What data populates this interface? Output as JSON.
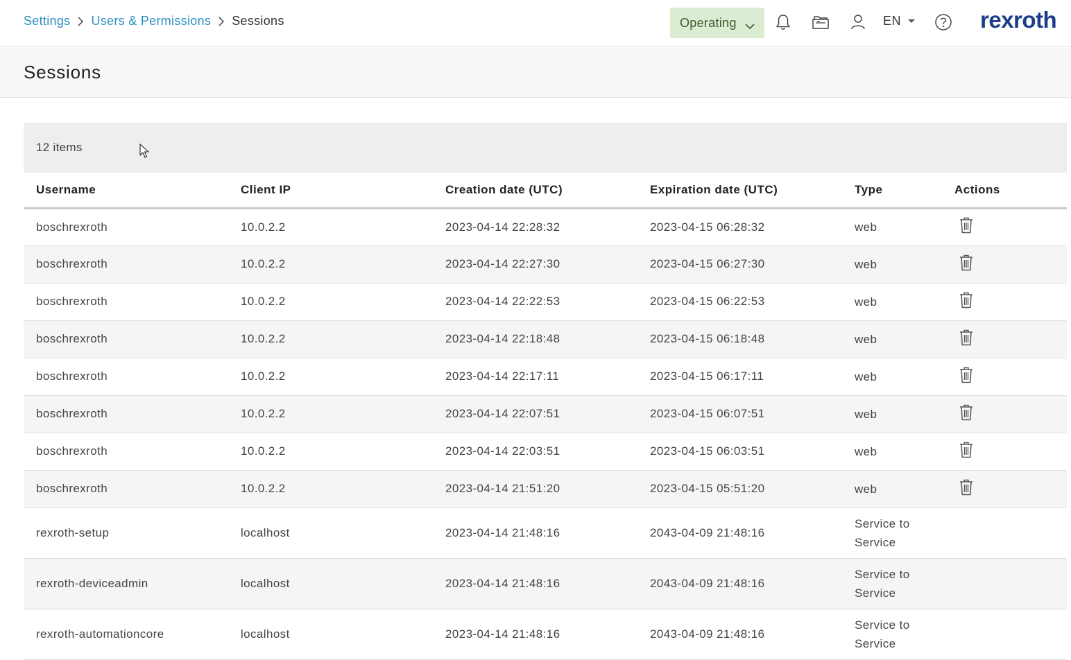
{
  "breadcrumb": {
    "items": [
      {
        "label": "Settings"
      },
      {
        "label": "Users & Permissions"
      }
    ],
    "current": "Sessions"
  },
  "header": {
    "mode_label": "Operating",
    "language": "EN",
    "icons": [
      "bell-icon",
      "folder-icon",
      "user-icon",
      "help-icon"
    ],
    "logo_text": "rexroth",
    "colors": {
      "mode_bg": "#dcecd2",
      "link": "#2a8fc0",
      "logo": "#1c3e8a"
    }
  },
  "page": {
    "title": "Sessions"
  },
  "table": {
    "count_label": "12 items",
    "columns": [
      "Username",
      "Client IP",
      "Creation date (UTC)",
      "Expiration date (UTC)",
      "Type",
      "Actions"
    ],
    "rows": [
      {
        "username": "boschrexroth",
        "ip": "10.0.2.2",
        "created": "2023-04-14 22:28:32",
        "expires": "2023-04-15 06:28:32",
        "type": "web",
        "deletable": true
      },
      {
        "username": "boschrexroth",
        "ip": "10.0.2.2",
        "created": "2023-04-14 22:27:30",
        "expires": "2023-04-15 06:27:30",
        "type": "web",
        "deletable": true
      },
      {
        "username": "boschrexroth",
        "ip": "10.0.2.2",
        "created": "2023-04-14 22:22:53",
        "expires": "2023-04-15 06:22:53",
        "type": "web",
        "deletable": true
      },
      {
        "username": "boschrexroth",
        "ip": "10.0.2.2",
        "created": "2023-04-14 22:18:48",
        "expires": "2023-04-15 06:18:48",
        "type": "web",
        "deletable": true
      },
      {
        "username": "boschrexroth",
        "ip": "10.0.2.2",
        "created": "2023-04-14 22:17:11",
        "expires": "2023-04-15 06:17:11",
        "type": "web",
        "deletable": true
      },
      {
        "username": "boschrexroth",
        "ip": "10.0.2.2",
        "created": "2023-04-14 22:07:51",
        "expires": "2023-04-15 06:07:51",
        "type": "web",
        "deletable": true
      },
      {
        "username": "boschrexroth",
        "ip": "10.0.2.2",
        "created": "2023-04-14 22:03:51",
        "expires": "2023-04-15 06:03:51",
        "type": "web",
        "deletable": true
      },
      {
        "username": "boschrexroth",
        "ip": "10.0.2.2",
        "created": "2023-04-14 21:51:20",
        "expires": "2023-04-15 05:51:20",
        "type": "web",
        "deletable": true
      },
      {
        "username": "rexroth-setup",
        "ip": "localhost",
        "created": "2023-04-14 21:48:16",
        "expires": "2043-04-09 21:48:16",
        "type": "Service to Service",
        "deletable": false
      },
      {
        "username": "rexroth-deviceadmin",
        "ip": "localhost",
        "created": "2023-04-14 21:48:16",
        "expires": "2043-04-09 21:48:16",
        "type": "Service to Service",
        "deletable": false
      },
      {
        "username": "rexroth-automationcore",
        "ip": "localhost",
        "created": "2023-04-14 21:48:16",
        "expires": "2043-04-09 21:48:16",
        "type": "Service to Service",
        "deletable": false
      }
    ]
  }
}
